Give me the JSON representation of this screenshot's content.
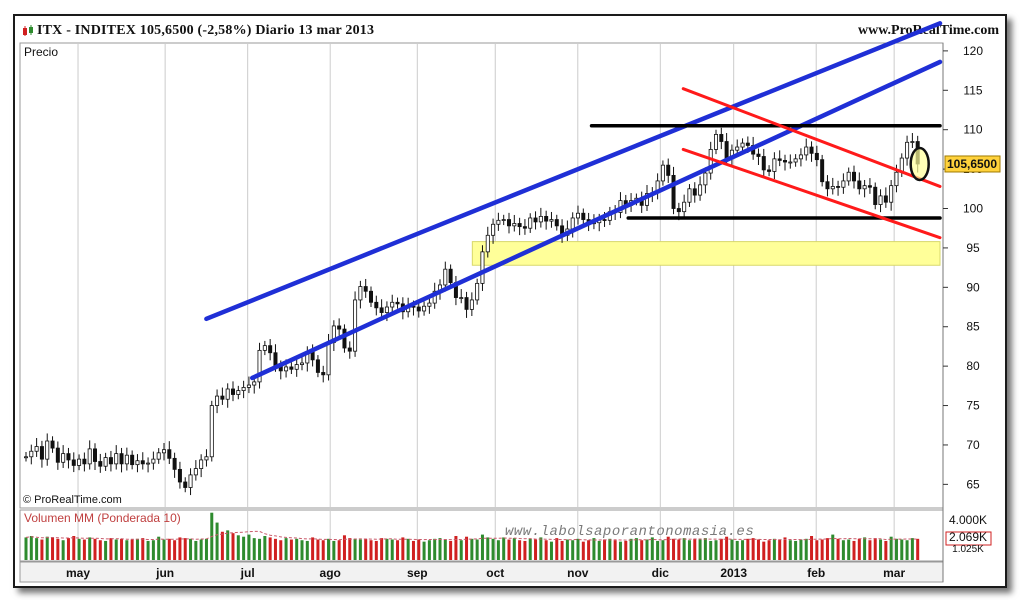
{
  "header": {
    "title": "ITX - INDITEX   105,6500 (-2,58%)   Diario  13 mar 2013",
    "site": "www.ProRealTime.com"
  },
  "price_panel": {
    "label": "Precio",
    "copyright": "© ProRealTime.com"
  },
  "volume_panel": {
    "label": "Volumen MM (Ponderada 10)",
    "watermark": "www.labolsaporantonomasia.es"
  },
  "colors": {
    "up": "#2e8b2e",
    "down": "#d02020",
    "channel": "#1f2fd6",
    "resistance": "#ff1a1a",
    "support": "#000000",
    "zone": "#ffff99",
    "price_tag": "#ffd23c",
    "volume_avg": "#c95a6a"
  },
  "chart_data": [
    {
      "type": "line",
      "ylabel": "Precio",
      "y_ticks": [
        120,
        115,
        110,
        105,
        100,
        95,
        90,
        85,
        80,
        75,
        70,
        65
      ],
      "ylim": [
        62,
        121
      ],
      "months": [
        "may",
        "jun",
        "jul",
        "ago",
        "sep",
        "oct",
        "nov",
        "dic",
        "2013",
        "feb",
        "mar"
      ],
      "current_price": "105,6500",
      "current_value": 105.65,
      "series": [
        {
          "values": [
            68.5,
            69.2,
            69.8,
            68.2,
            70.5,
            69.6,
            67.8,
            68.9,
            68.1,
            67.4,
            68.2,
            67.6,
            69.5,
            67.9,
            67.3,
            68.4,
            67.6,
            68.9,
            67.6,
            68.7,
            67.5,
            68.0,
            67.6,
            67.7,
            68.2,
            69.0,
            69.4,
            68.3,
            66.9,
            65.3,
            64.6,
            66.2,
            67.0,
            68.1,
            68.5,
            75.0,
            76.2,
            75.8,
            77.1,
            76.4,
            76.9,
            77.3,
            77.6,
            78.0,
            82.0,
            82.6,
            81.7,
            80.0,
            79.4,
            79.9,
            79.6,
            80.2,
            80.4,
            81.8,
            80.8,
            79.2,
            78.9,
            83.0,
            85.1,
            84.7,
            82.3,
            81.9,
            88.4,
            90.1,
            89.5,
            88.1,
            87.4,
            86.8,
            87.5,
            88.1,
            87.9,
            86.9,
            87.6,
            87.5,
            87.0,
            87.6,
            88.0,
            89.5,
            90.3,
            92.3,
            90.6,
            88.7,
            88.7,
            87.2,
            88.4,
            90.5,
            94.5,
            96.6,
            98.0,
            98.5,
            98.6,
            97.8,
            98.1,
            97.7,
            97.5,
            98.8,
            98.3,
            99.0,
            98.4,
            98.6,
            97.8,
            96.6,
            97.4,
            98.8,
            99.4,
            98.6,
            98.1,
            98.2,
            98.6,
            98.5,
            99.6,
            99.5,
            101.0,
            100.4,
            101.0,
            101.3,
            100.4,
            101.9,
            102.0,
            103.5,
            105.5,
            104.2,
            100.0,
            99.6,
            100.8,
            102.5,
            101.7,
            103.0,
            104.5,
            107.5,
            109.4,
            108.5,
            106.4,
            107.4,
            107.8,
            108.3,
            108.0,
            106.9,
            106.6,
            104.9,
            104.7,
            106.3,
            106.1,
            105.9,
            105.9,
            106.3,
            106.8,
            107.8,
            107.0,
            106.2,
            103.4,
            102.5,
            102.8,
            102.7,
            103.5,
            104.6,
            103.5,
            102.5,
            102.9,
            102.7,
            100.5,
            101.6,
            100.8,
            102.9,
            104.6,
            106.4,
            108.4,
            108.5,
            105.65
          ]
        }
      ],
      "annotations": {
        "upper_channel": {
          "from": [
            0.2,
            86.0
          ],
          "to": [
            1.0,
            123.5
          ]
        },
        "lower_channel": {
          "from": [
            0.25,
            78.5
          ],
          "to": [
            1.0,
            118.6
          ]
        },
        "upper_resistance": {
          "from": [
            0.72,
            115.2
          ],
          "to": [
            1.0,
            102.8
          ]
        },
        "lower_resistance": {
          "from": [
            0.72,
            107.5
          ],
          "to": [
            1.0,
            96.3
          ]
        },
        "resistance_line_110": {
          "from": [
            0.62,
            110.5
          ],
          "to": [
            1.0,
            110.5
          ]
        },
        "support_line_98": {
          "from": [
            0.66,
            98.8
          ],
          "to": [
            1.0,
            98.8
          ]
        },
        "support_zone": {
          "from": [
            0.49,
            92.8
          ],
          "to": [
            1.0,
            95.8
          ]
        }
      }
    },
    {
      "type": "bar",
      "ylabel": "Volumen MM (Ponderada 10)",
      "y_ticks": [
        "4.000K",
        "2.069K",
        "1.025K"
      ],
      "series": [
        {
          "name": "Volumen MM (Ponderada 10)",
          "values": [
            3.2,
            3.4,
            3.1,
            2.9,
            3.3,
            3.2,
            3.0,
            2.8,
            3.1,
            3.4,
            3.0,
            2.9,
            3.2,
            3.0,
            2.8,
            2.7,
            3.1,
            2.9,
            3.0,
            2.8,
            2.9,
            3.0,
            3.1,
            2.7,
            2.8,
            3.3,
            2.9,
            3.0,
            2.8,
            3.2,
            3.1,
            3.0,
            2.7,
            2.9,
            3.0,
            6.7,
            5.3,
            4.0,
            4.2,
            3.8,
            3.5,
            3.3,
            3.6,
            3.1,
            3.0,
            3.4,
            3.2,
            3.0,
            2.8,
            3.1,
            2.9,
            3.0,
            2.8,
            2.7,
            3.2,
            2.9,
            2.8,
            3.0,
            2.7,
            2.8,
            3.5,
            3.1,
            3.0,
            2.9,
            3.0,
            2.8,
            2.7,
            3.1,
            3.0,
            2.9,
            2.8,
            3.2,
            3.0,
            2.7,
            2.9,
            2.6,
            2.8,
            3.0,
            3.1,
            2.9,
            2.7,
            3.4,
            2.8,
            3.3,
            3.0,
            2.9,
            3.6,
            3.2,
            3.0,
            2.8,
            3.2,
            2.9,
            3.1,
            2.8,
            2.7,
            3.0,
            2.9,
            3.2,
            2.8,
            2.6,
            3.1,
            2.7,
            2.9,
            2.8,
            3.0,
            2.6,
            2.8,
            3.1,
            2.7,
            2.9,
            3.0,
            2.8,
            2.6,
            2.7,
            3.0,
            3.1,
            2.8,
            2.9,
            3.2,
            2.7,
            2.8,
            3.3,
            3.0,
            2.9,
            3.1,
            2.8,
            3.0,
            2.9,
            3.1,
            2.7,
            2.8,
            3.0,
            3.3,
            2.9,
            2.7,
            2.8,
            3.0,
            3.1,
            2.9,
            2.6,
            2.8,
            3.0,
            2.9,
            3.2,
            2.8,
            2.7,
            2.9,
            3.0,
            3.4,
            2.8,
            2.9,
            3.1,
            3.6,
            3.0,
            2.8,
            2.9,
            2.7,
            3.0,
            3.2,
            2.8,
            3.1,
            2.9,
            2.7,
            3.3,
            3.0,
            2.9,
            2.8,
            3.1,
            3.0,
            2.9,
            3.6
          ]
        }
      ]
    }
  ]
}
